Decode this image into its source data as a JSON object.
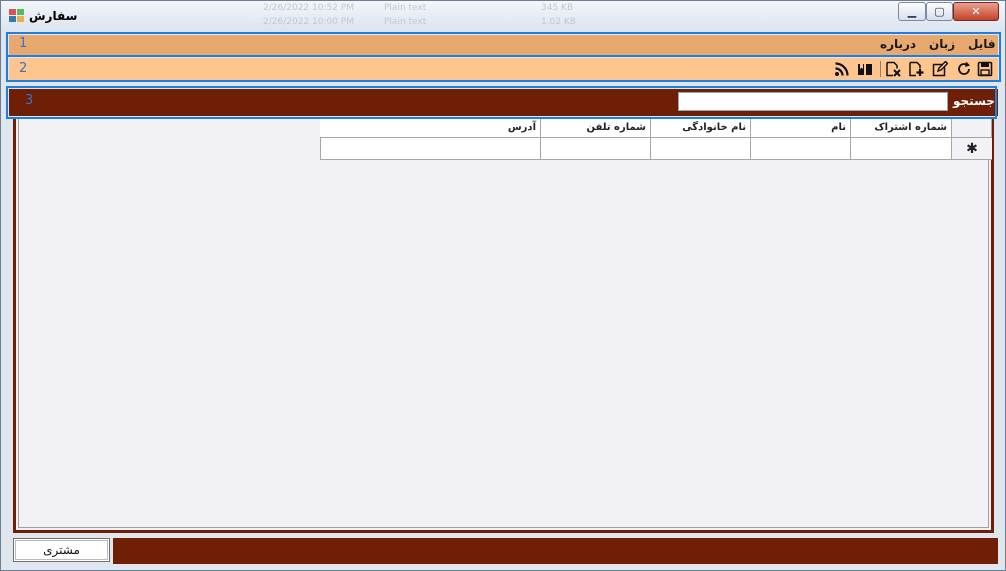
{
  "window": {
    "title": "سفارش",
    "ghost_rows": [
      "2/26/2022 10:52 PM",
      "Plain text",
      "345 KB",
      "2/26/2022 10:00 PM",
      "Plain text",
      "1.02 KB"
    ],
    "controls": {
      "minimize": "▁",
      "maximize": "▢",
      "close": "✕"
    }
  },
  "menu": {
    "items": [
      "فایل",
      "زبان",
      "درباره"
    ]
  },
  "toolbar": {
    "icons": [
      "save-icon",
      "refresh-icon",
      "edit-icon",
      "add-icon",
      "delete-icon",
      "book-icon",
      "rss-icon"
    ]
  },
  "search": {
    "label": "جستجو",
    "value": ""
  },
  "grid": {
    "columns": [
      "شماره اشتراک",
      "نام",
      "نام خانوادگی",
      "شماره تلفن",
      "آدرس"
    ],
    "new_row_marker": "✱"
  },
  "tabs": {
    "customer": "مشتری"
  },
  "annotations": [
    "1",
    "2",
    "3"
  ],
  "colors": {
    "menubar": "#e8a96e",
    "toolbar": "#ffc58f",
    "dark_brown": "#6e1f05",
    "outline": "#1e7fe0"
  }
}
